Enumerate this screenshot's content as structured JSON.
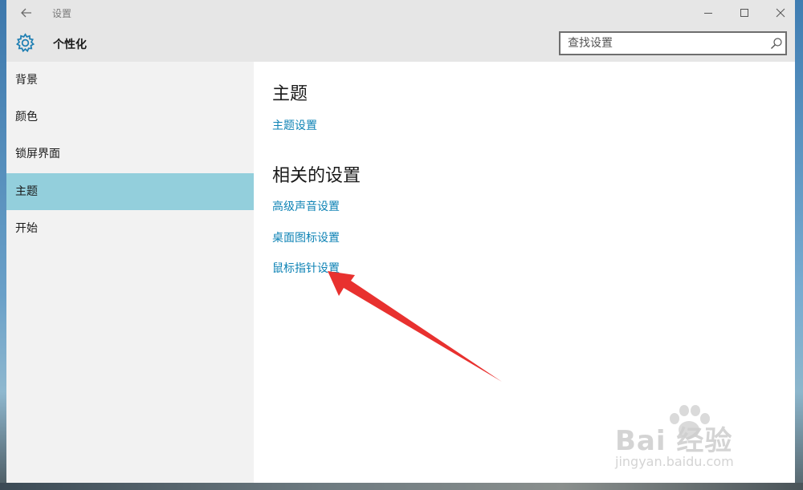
{
  "window": {
    "title": "设置",
    "section_title": "个性化",
    "search": {
      "placeholder": "查找设置"
    }
  },
  "sidebar": {
    "items": [
      {
        "label": "背景"
      },
      {
        "label": "颜色"
      },
      {
        "label": "锁屏界面"
      },
      {
        "label": "主题",
        "selected": true
      },
      {
        "label": "开始"
      }
    ]
  },
  "content": {
    "theme_heading": "主题",
    "theme_settings_link": "主题设置",
    "related_heading": "相关的设置",
    "related_links": [
      {
        "label": "高级声音设置"
      },
      {
        "label": "桌面图标设置"
      },
      {
        "label": "鼠标指针设置"
      }
    ]
  },
  "annotation": {
    "arrow_color": "#e8312f"
  },
  "watermark": {
    "brand": "Bai  经验",
    "url": "jingyan.baidu.com"
  },
  "colors": {
    "accent": "#0e83b5",
    "selected_item": "#93cfdc",
    "chrome": "#e6e6e6",
    "sidebar": "#f2f2f2"
  },
  "icons": [
    "back-arrow-icon",
    "minimize-icon",
    "maximize-icon",
    "close-icon",
    "gear-icon",
    "search-icon",
    "paw-icon"
  ]
}
